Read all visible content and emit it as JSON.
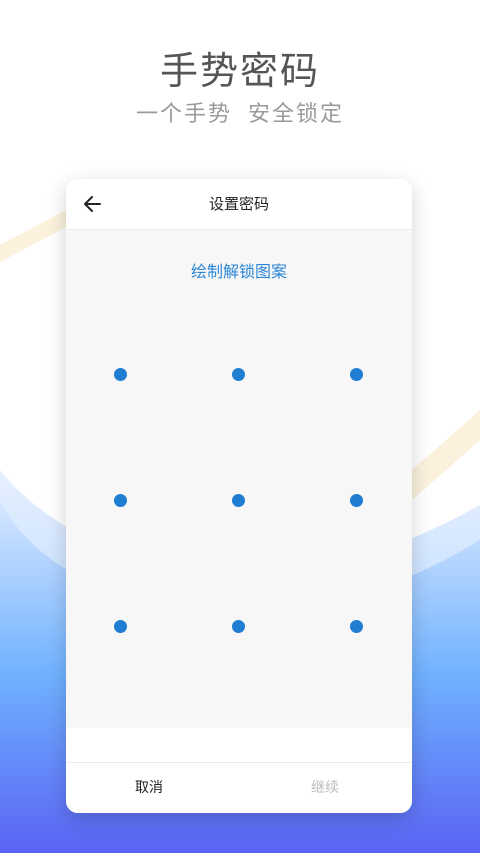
{
  "hero": {
    "title": "手势密码",
    "subtitle_part1": "一个手势",
    "subtitle_part2": "安全锁定"
  },
  "screen": {
    "title": "设置密码",
    "back_icon": "arrow-left-icon",
    "hint": "绘制解锁图案",
    "grid_size": 9,
    "cancel_label": "取消",
    "continue_label": "继续"
  },
  "colors": {
    "accent": "#1f7dd2",
    "hint": "#2b86d6",
    "disabled": "#bcbcbc",
    "bg_blue_top": "#cfe3ff",
    "bg_blue_bottom": "#5b6cf5",
    "deco_stripe": "#fbf1dd"
  }
}
